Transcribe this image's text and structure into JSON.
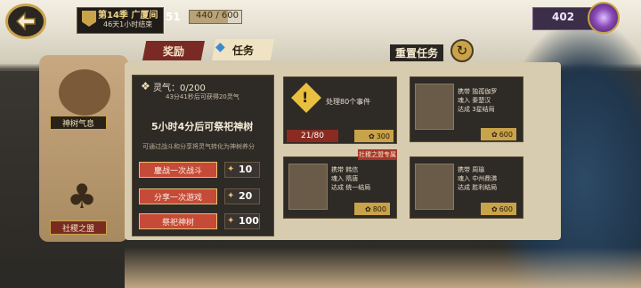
{
  "season": {
    "title": "第14季 广厦间",
    "timer": "46天1小时结束"
  },
  "player": {
    "level": "51",
    "xp_text": "440 / 600",
    "xp_fraction": 0.733
  },
  "currency": {
    "value": "402"
  },
  "tabs": {
    "reward": "奖励",
    "task": "任务",
    "reset": "重置任务"
  },
  "sidebar": {
    "spirit_button": "神树气息",
    "altar_button": "社稷之盟"
  },
  "info": {
    "spirit_label": "灵气：0/200",
    "spirit_hint": "43分41秒后可获得20灵气",
    "ritual_time": "5小时4分后可祭祀神树",
    "convert_note": "可通过战斗和分享将灵气转化为神树养分"
  },
  "actions": [
    {
      "label": "鏖战一次战斗",
      "value": "10"
    },
    {
      "label": "分享一次游戏",
      "value": "20"
    },
    {
      "label": "祭祀神树",
      "value": "100"
    }
  ],
  "cards": {
    "events": {
      "title": "处理80个事件",
      "progress": "21/80",
      "reward": "300"
    },
    "hero1": {
      "lines": [
        "携带 独孤伽罗",
        "魂入 秦楚汉",
        "达成 3星结局"
      ],
      "reward": "600"
    },
    "hero2": {
      "lines": [
        "携带 韩信",
        "魂入 隋唐",
        "达成 统一结局"
      ],
      "reward": "800",
      "tag": "社稷之盟专属"
    },
    "hero3": {
      "lines": [
        "携带 周瑜",
        "魂入 中州鼎沸",
        "达成 胜利结局"
      ],
      "reward": "600"
    }
  },
  "colors": {
    "accent_gold": "#c9a34a",
    "accent_red": "#c54a38",
    "panel_dark": "#2e2a26"
  }
}
